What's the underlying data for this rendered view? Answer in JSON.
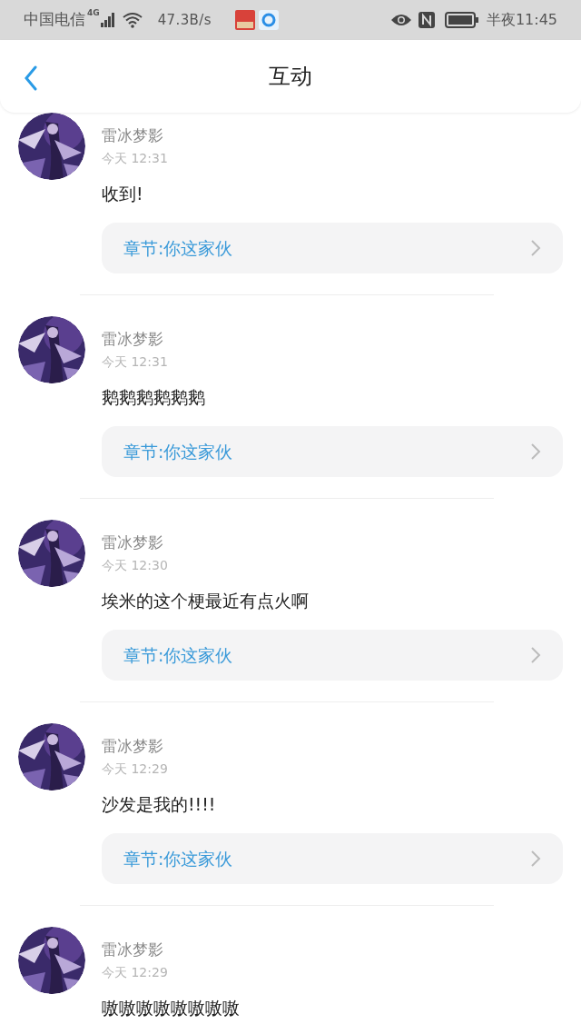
{
  "status_bar": {
    "carrier": "中国电信",
    "network": "4G",
    "speed": "47.3B/s",
    "time": "半夜11:45"
  },
  "header": {
    "title": "互动"
  },
  "comments": [
    {
      "name": "雷冰梦影",
      "time": "今天 12:31",
      "content": "收到!",
      "chapter": "章节:你这家伙"
    },
    {
      "name": "雷冰梦影",
      "time": "今天 12:31",
      "content": "鹅鹅鹅鹅鹅鹅",
      "chapter": "章节:你这家伙"
    },
    {
      "name": "雷冰梦影",
      "time": "今天 12:30",
      "content": "埃米的这个梗最近有点火啊",
      "chapter": "章节:你这家伙"
    },
    {
      "name": "雷冰梦影",
      "time": "今天 12:29",
      "content": "沙发是我的!!!!",
      "chapter": "章节:你这家伙"
    },
    {
      "name": "雷冰梦影",
      "time": "今天 12:29",
      "content": "嗷嗷嗷嗷嗷嗷嗷嗷"
    }
  ]
}
